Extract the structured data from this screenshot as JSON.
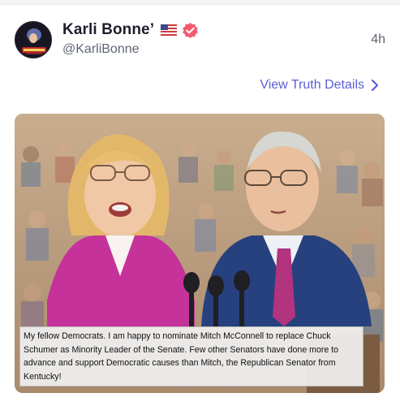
{
  "post": {
    "author": {
      "display_name": "Karli Bonne’",
      "handle": "@KarliBonne",
      "flag_icon": "us-flag-icon",
      "verified_icon": "verified-badge-icon",
      "verified_color": "#f35b6e"
    },
    "timestamp": "4h",
    "details_link": "View Truth Details",
    "link_color": "#5a5fd6"
  },
  "media": {
    "caption": "My fellow Democrats. I am happy to nominate Mitch McConnell to replace Chuck Schumer as Minority Leader of the Senate. Few other Senators have done more to advance and support Democratic causes than Mitch, the Republican Senator from Kentucky!"
  }
}
